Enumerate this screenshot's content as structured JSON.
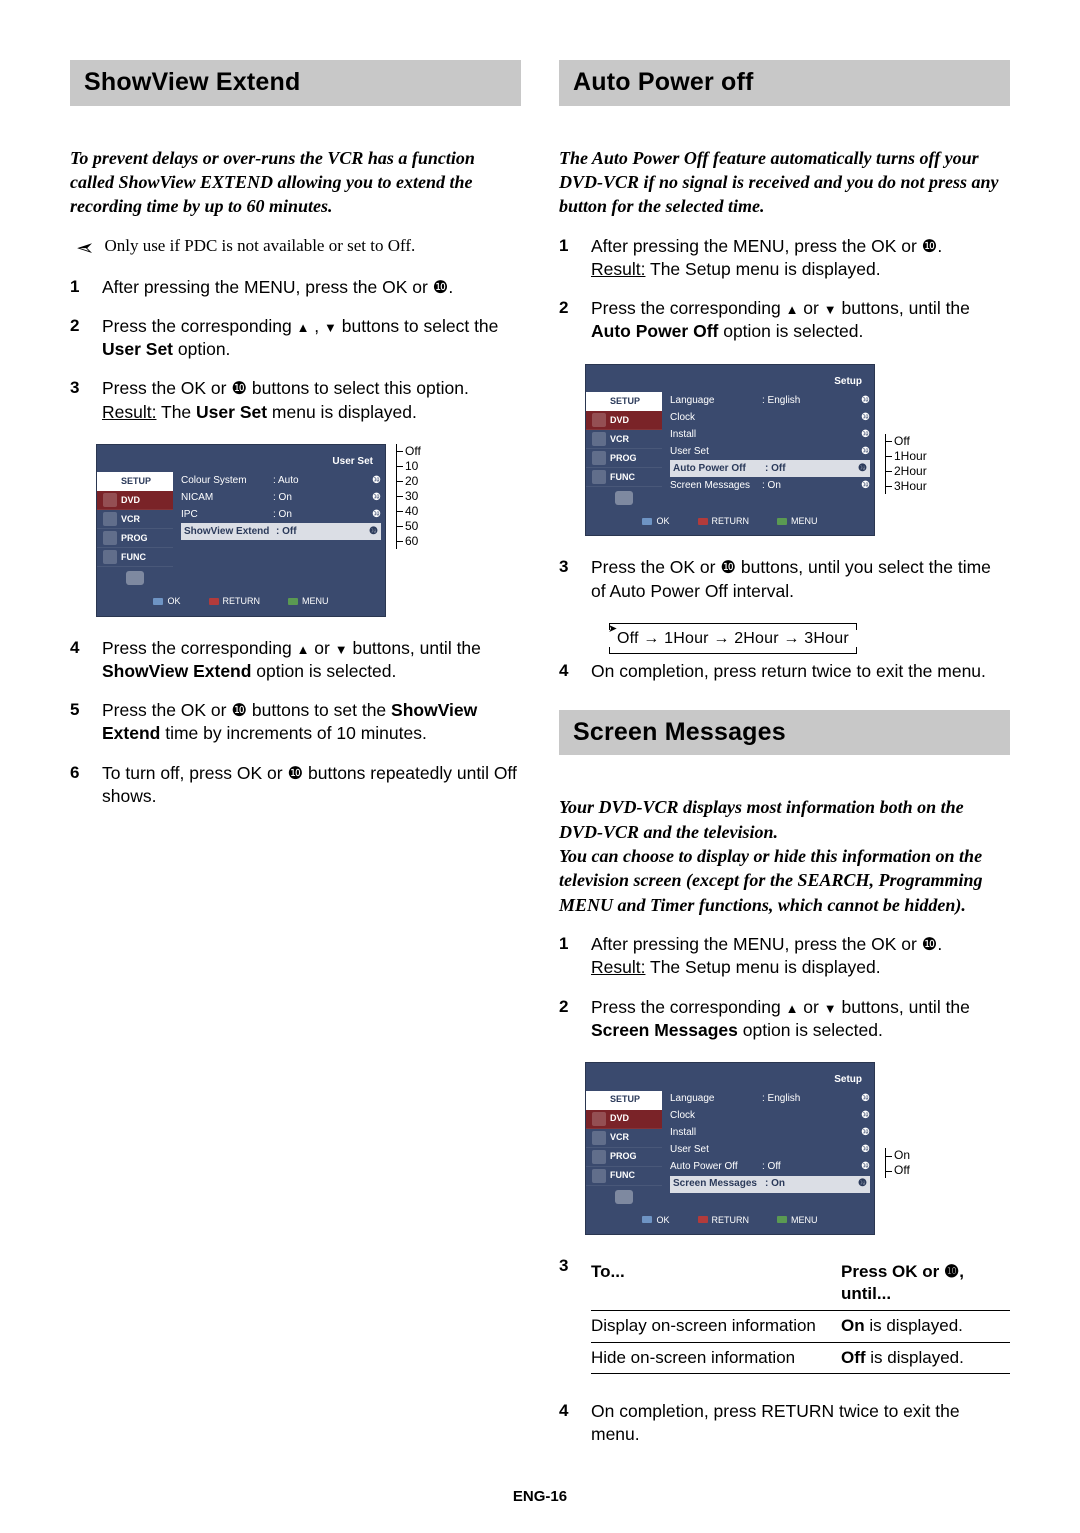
{
  "left": {
    "header": "ShowView Extend",
    "intro": "To prevent delays or over-runs the VCR has a function called ShowView EXTEND allowing you to extend the recording time by up to 60 minutes.",
    "note": "Only use if PDC is not available or set to Off.",
    "steps": {
      "s1": "After pressing the MENU, press the OK or ❿.",
      "s2a": "Press the corresponding ",
      "s2b": " buttons to select the ",
      "s2c": "User Set",
      "s2d": " option.",
      "s3a": "Press the OK or ❿ buttons to select this option.",
      "s3b": "Result:",
      "s3c": " The ",
      "s3d": "User Set",
      "s3e": " menu is displayed.",
      "s4a": "Press the corresponding ",
      "s4b": " buttons, until the ",
      "s4c": "ShowView Extend",
      "s4d": " option is selected.",
      "s5a": "Press the OK or ❿ buttons to set the ",
      "s5b": "ShowView Extend",
      "s5c": " time by increments of 10 minutes.",
      "s6": "To turn off, press OK or ❿ buttons repeatedly until Off shows."
    },
    "menu": {
      "title": "User Set",
      "tabs": [
        "SETUP",
        "DVD",
        "VCR",
        "PROG",
        "FUNC"
      ],
      "rows": [
        {
          "lbl": "Colour System",
          "val": ": Auto",
          "sel": false
        },
        {
          "lbl": "NICAM",
          "val": ": On",
          "sel": false
        },
        {
          "lbl": "IPC",
          "val": ": On",
          "sel": false
        },
        {
          "lbl": "ShowView Extend",
          "val": ": Off",
          "sel": true
        }
      ],
      "footer": {
        "ok": "OK",
        "ret": "RETURN",
        "menu": "MENU"
      },
      "options": [
        "Off",
        "10",
        "20",
        "30",
        "40",
        "50",
        "60"
      ]
    }
  },
  "rightA": {
    "header": "Auto Power off",
    "intro": "The Auto Power Off feature automatically turns off your DVD-VCR if no signal is received and you do not press any button for the selected time.",
    "steps": {
      "s1a": "After pressing the MENU, press the OK or ❿.",
      "s1b": "Result:",
      "s1c": " The Setup menu is displayed.",
      "s2a": "Press the corresponding ",
      "s2b": " buttons, until the ",
      "s2c": "Auto Power Off",
      "s2d": " option is selected.",
      "s3": "Press the OK or ❿ buttons, until you select the time of Auto Power Off interval.",
      "chain": "Off  →  1Hour  →  2Hour  →  3Hour",
      "s4": "On completion, press return twice to exit the menu."
    },
    "menu": {
      "title": "Setup",
      "tabs": [
        "SETUP",
        "DVD",
        "VCR",
        "PROG",
        "FUNC"
      ],
      "rows": [
        {
          "lbl": "Language",
          "val": ": English"
        },
        {
          "lbl": "Clock",
          "val": ""
        },
        {
          "lbl": "Install",
          "val": ""
        },
        {
          "lbl": "User Set",
          "val": ""
        },
        {
          "lbl": "Auto Power Off",
          "val": ": Off",
          "sel": true
        },
        {
          "lbl": "Screen Messages",
          "val": ": On"
        }
      ],
      "footer": {
        "ok": "OK",
        "ret": "RETURN",
        "menu": "MENU"
      },
      "options": [
        "Off",
        "1Hour",
        "2Hour",
        "3Hour"
      ]
    }
  },
  "rightB": {
    "header": "Screen Messages",
    "intro": "Your DVD-VCR displays most information both on the DVD-VCR and the television.\nYou can choose to display or hide this information on the television screen (except for the SEARCH, Programming MENU and Timer functions, which cannot be hidden).",
    "steps": {
      "s1a": "After pressing the MENU, press the OK or ❿.",
      "s1b": "Result:",
      "s1c": " The Setup menu is displayed.",
      "s2a": "Press the corresponding ",
      "s2b": " buttons, until the ",
      "s2c": "Screen Messages",
      "s2d": " option is selected.",
      "s4": "On completion, press RETURN twice to exit the menu."
    },
    "menu": {
      "title": "Setup",
      "tabs": [
        "SETUP",
        "DVD",
        "VCR",
        "PROG",
        "FUNC"
      ],
      "rows": [
        {
          "lbl": "Language",
          "val": ": English"
        },
        {
          "lbl": "Clock",
          "val": ""
        },
        {
          "lbl": "Install",
          "val": ""
        },
        {
          "lbl": "User Set",
          "val": ""
        },
        {
          "lbl": "Auto Power Off",
          "val": ": Off"
        },
        {
          "lbl": "Screen Messages",
          "val": ": On",
          "sel": true
        }
      ],
      "footer": {
        "ok": "OK",
        "ret": "RETURN",
        "menu": "MENU"
      },
      "options": [
        "On",
        "Off"
      ]
    },
    "table": {
      "h1": "To...",
      "h2": "Press OK or ❿, until...",
      "r1a": "Display on-screen information",
      "r1b1": "On",
      "r1b2": " is displayed.",
      "r2a": "Hide on-screen information",
      "r2b1": "Off",
      "r2b2": " is displayed."
    }
  },
  "pageNum": "ENG-16"
}
